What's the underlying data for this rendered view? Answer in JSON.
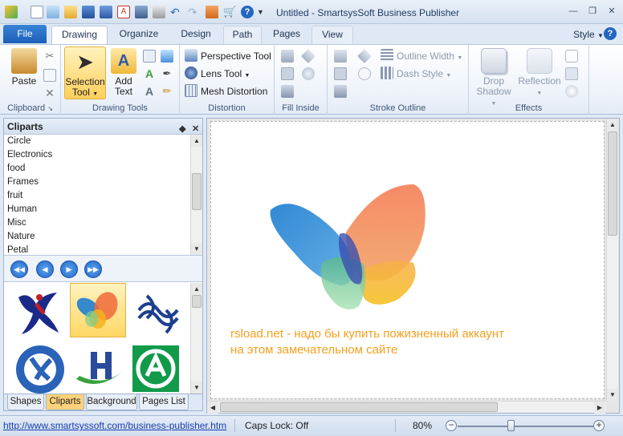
{
  "window": {
    "title": "Untitled - SmartsysSoft Business Publisher",
    "controls": [
      "minimize-icon",
      "restore-icon",
      "close-icon"
    ]
  },
  "quick_access": [
    "app-icon",
    "new-icon",
    "open-template-icon",
    "open-icon",
    "save-icon",
    "save-as-icon",
    "pdf-icon",
    "export-icon",
    "print-icon",
    "undo-icon",
    "redo-icon",
    "paint-icon",
    "cart-icon",
    "help-icon",
    "customize-icon"
  ],
  "tabs": {
    "file": "File",
    "items": [
      "Drawing",
      "Organize",
      "Design",
      "Path",
      "Pages",
      "View"
    ],
    "active": "Drawing",
    "style_menu": "Style",
    "help_glyph": "?"
  },
  "ribbon": {
    "clipboard": {
      "label": "Clipboard",
      "paste": "Paste"
    },
    "drawing_tools": {
      "label": "Drawing Tools",
      "selection_tool": "Selection",
      "selection_tool_2": "Tool",
      "add_text": "Add",
      "add_text_2": "Text"
    },
    "distortion": {
      "label": "Distortion",
      "perspective": "Perspective Tool",
      "lens": "Lens Tool",
      "mesh": "Mesh Distortion"
    },
    "fill_inside": {
      "label": "Fill Inside"
    },
    "stroke_outline": {
      "label": "Stroke Outline",
      "outline_width": "Outline Width",
      "dash_style": "Dash Style"
    },
    "effects": {
      "label": "Effects",
      "drop_shadow": "Drop",
      "drop_shadow_2": "Shadow",
      "reflection": "Reflection"
    }
  },
  "cliparts_panel": {
    "title": "Cliparts",
    "pin_glyph": "◆",
    "close_glyph": "✕",
    "categories": [
      "Circle",
      "Electronics",
      "food",
      "Frames",
      "fruit",
      "Human",
      "Misc",
      "Nature",
      "Petal"
    ],
    "bottom_tabs": [
      "Shapes",
      "Cliparts",
      "Background",
      "Pages List"
    ],
    "active_tab": "Cliparts"
  },
  "canvas": {
    "caption_line1": "rsload.net - надо бы купить пожизненный аккаунт",
    "caption_line2": "на этом замечательном сайте"
  },
  "statusbar": {
    "url": "http://www.smartsyssoft.com/business-publisher.htm",
    "caps_lock": "Caps Lock: Off",
    "zoom": "80%",
    "zoom_level": 0.8
  },
  "colors": {
    "accent": "#1b5fb8",
    "caption": "#f5a020",
    "selection_highlight": "#ffd766"
  }
}
